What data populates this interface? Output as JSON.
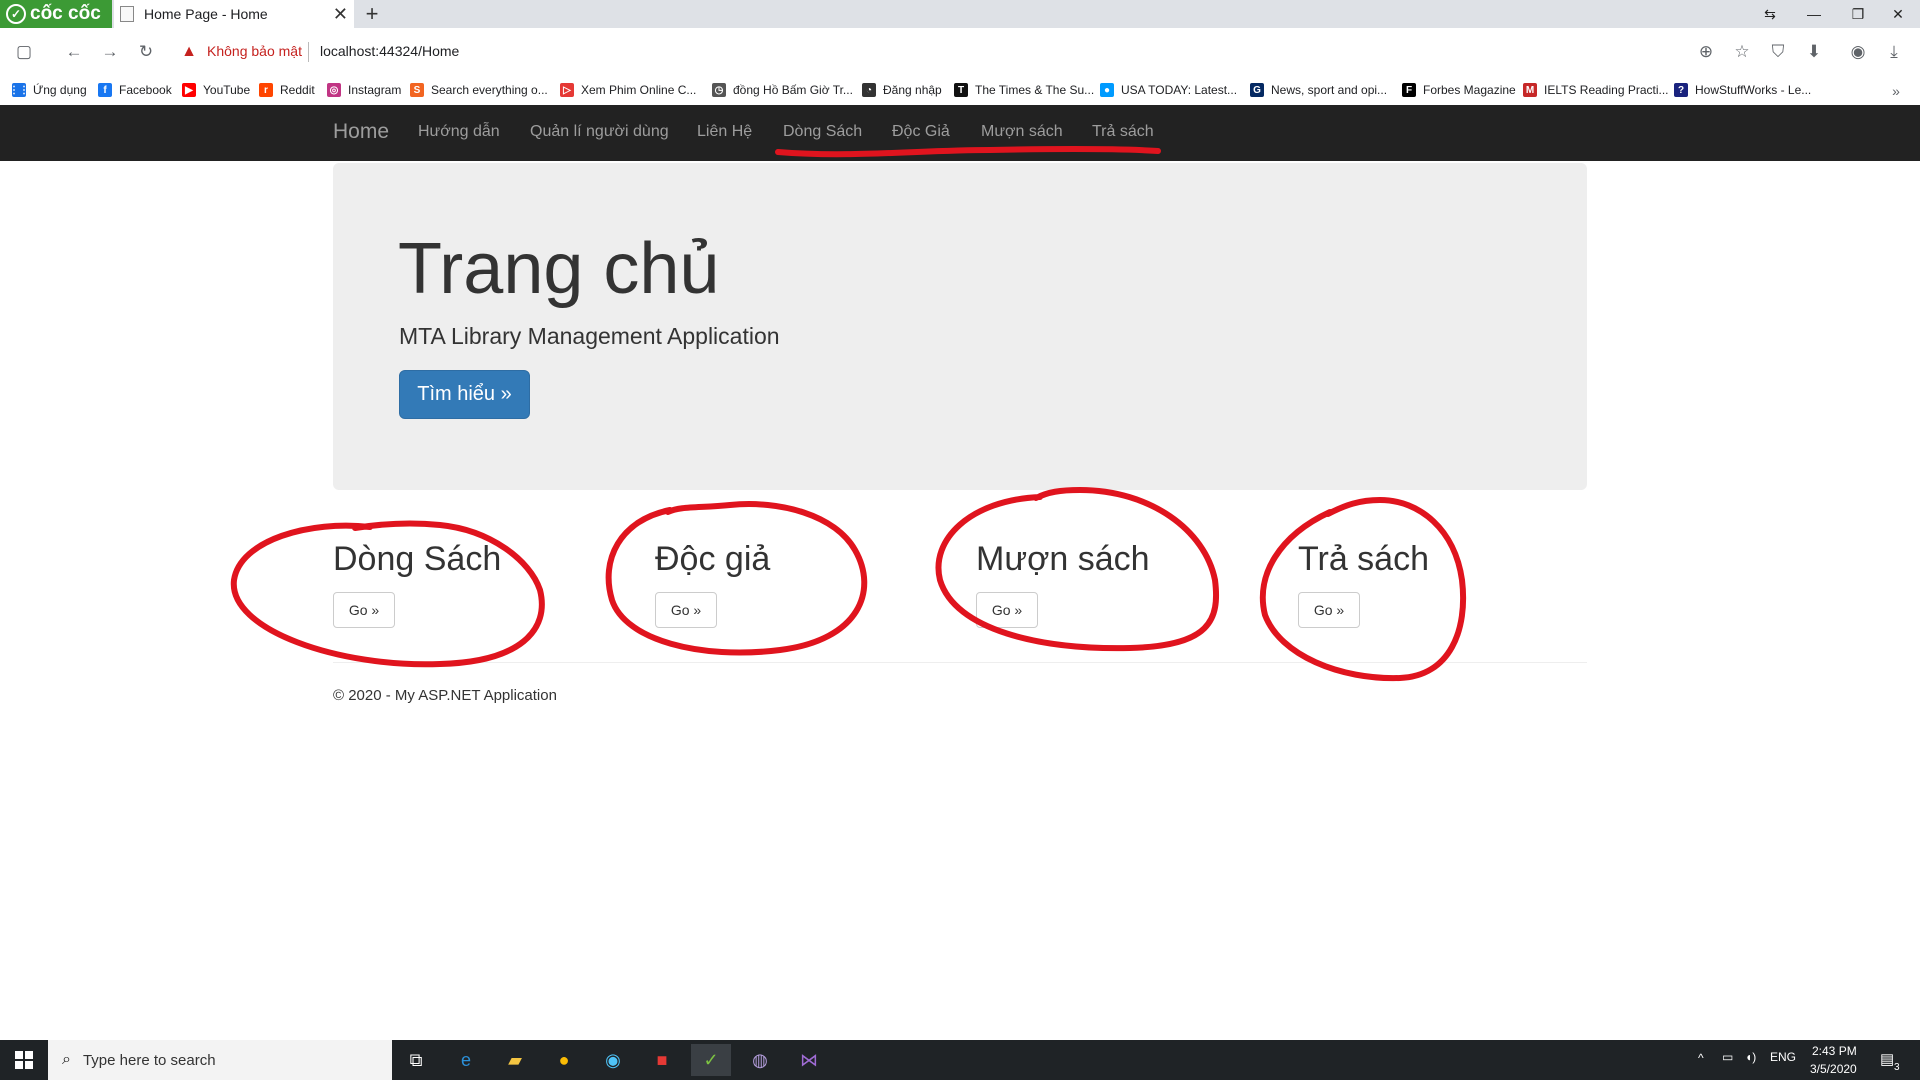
{
  "browser": {
    "brand": "cốc cốc",
    "tab_title": "Home Page - Home",
    "security_warning": "Không bảo mật",
    "url": "localhost:44324/Home",
    "bookmarks": [
      {
        "label": "Ứng dụng",
        "color": "#1a73e8"
      },
      {
        "label": "Facebook",
        "color": "#1877f2"
      },
      {
        "label": "YouTube",
        "color": "#ff0000"
      },
      {
        "label": "Reddit",
        "color": "#ff4500"
      },
      {
        "label": "Instagram",
        "color": "#c13584"
      },
      {
        "label": "Search everything o...",
        "color": "#f26522"
      },
      {
        "label": "Xem Phim Online C...",
        "color": "#e53935"
      },
      {
        "label": "đồng Hồ Bấm Giờ Tr...",
        "color": "#555555"
      },
      {
        "label": "Đăng nhập",
        "color": "#333333"
      },
      {
        "label": "The Times & The Su...",
        "color": "#111111"
      },
      {
        "label": "USA TODAY: Latest...",
        "color": "#009bff"
      },
      {
        "label": "News, sport and opi...",
        "color": "#052962"
      },
      {
        "label": "Forbes Magazine",
        "color": "#000000"
      },
      {
        "label": "IELTS Reading Practi...",
        "color": "#c62828"
      },
      {
        "label": "HowStuffWorks - Le...",
        "color": "#1a237e"
      }
    ]
  },
  "navbar": {
    "home": "Home",
    "items": [
      "Hướng dẫn",
      "Quản lí người dùng",
      "Liên Hệ",
      "Dòng Sách",
      "Độc Giả",
      "Mượn sách",
      "Trả sách"
    ]
  },
  "jumbotron": {
    "title": "Trang chủ",
    "subtitle": "MTA Library Management Application",
    "button": "Tìm hiểu »"
  },
  "columns": [
    {
      "title": "Dòng Sách",
      "button": "Go »"
    },
    {
      "title": "Độc giả",
      "button": "Go »"
    },
    {
      "title": "Mượn sách",
      "button": "Go »"
    },
    {
      "title": "Trả sách",
      "button": "Go »"
    }
  ],
  "footer": "© 2020 - My ASP.NET Application",
  "taskbar": {
    "search_placeholder": "Type here to search",
    "language": "ENG",
    "time": "2:43 PM",
    "date": "3/5/2020",
    "notification_count": "3"
  },
  "colors": {
    "annotation": "#e0141e",
    "primary": "#337ab7",
    "navbar": "#222222"
  }
}
